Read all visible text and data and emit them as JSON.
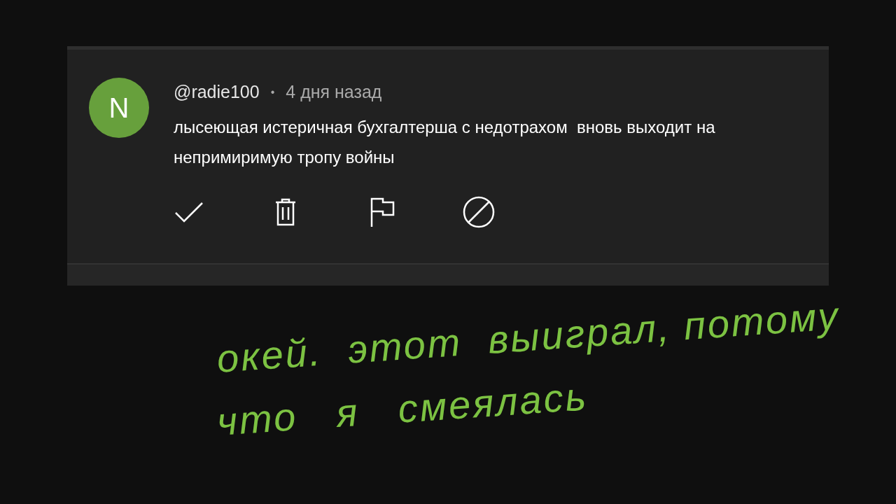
{
  "comment": {
    "avatar_letter": "N",
    "color": "#67a03c",
    "author": "@radie100",
    "separator": "•",
    "time": "4 дня назад",
    "text": "лысеющая истеричная бухгалтерша с недотрахом  вновь выходит на непримиримую тропу войны"
  },
  "actions": [
    {
      "kind": "approve"
    },
    {
      "kind": "remove"
    },
    {
      "kind": "report"
    },
    {
      "kind": "block"
    }
  ],
  "note": {
    "lines": [
      "окей.  этот  выиграл, потому",
      "что   я   смеялась"
    ],
    "color": "#7cc242"
  }
}
